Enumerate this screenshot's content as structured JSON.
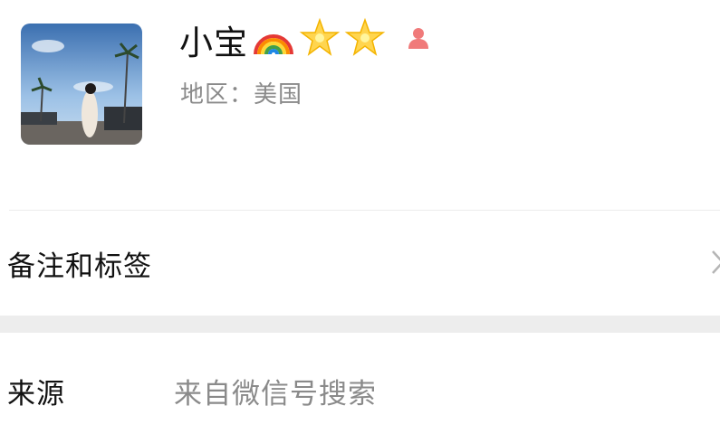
{
  "profile": {
    "name": "小宝",
    "name_emojis": [
      "rainbow-icon",
      "star-icon",
      "star-icon"
    ],
    "gender_icon": "person-female-icon",
    "gender_color": "#f07a7a",
    "region": "地区：美国"
  },
  "remark_row": {
    "label": "备注和标签",
    "chevron": "chevron-right-icon"
  },
  "source_row": {
    "label": "来源",
    "value": "来自微信号搜索"
  }
}
